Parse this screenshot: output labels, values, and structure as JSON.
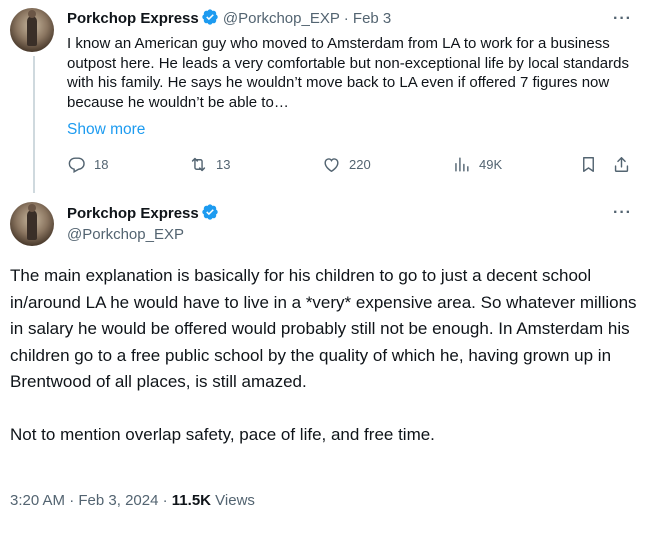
{
  "tweet1": {
    "author_name": "Porkchop Express",
    "handle": "@Porkchop_EXP",
    "separator": "·",
    "date": "Feb 3",
    "text": "I know an American guy who moved to Amsterdam from LA to work for a business outpost here. He leads a very comfortable but non-exceptional life by local standards with his family. He says he wouldn’t move back to LA even if offered 7 figures now because he wouldn’t be able to…",
    "show_more": "Show more",
    "actions": {
      "replies": "18",
      "reposts": "13",
      "likes": "220",
      "views": "49K"
    }
  },
  "tweet2": {
    "author_name": "Porkchop Express",
    "handle": "@Porkchop_EXP",
    "paragraph1": "The main explanation is basically for his children to go to just a decent school in/around LA he would have to live in a *very* expensive area. So whatever millions in salary he would be offered would probably still not be enough. In Amsterdam his children go to a free public school by the quality of which he, having grown up in Brentwood of all places, is still amazed.",
    "paragraph2": "Not to mention overlap safety, pace of life, and free time.",
    "time": "3:20 AM",
    "separator": "·",
    "date": "Feb 3, 2024",
    "views_count": "11.5K",
    "views_label": "Views"
  },
  "icons": {
    "more": "more-icon",
    "verified": "verified-badge-icon",
    "reply": "reply-icon",
    "repost": "repost-icon",
    "like": "heart-icon",
    "views": "views-icon",
    "bookmark": "bookmark-icon",
    "share": "share-icon"
  },
  "colors": {
    "text": "#0f1419",
    "secondary": "#536471",
    "link": "#1d9bf0",
    "verified": "#1d9bf0",
    "thread_line": "#cfd9de"
  }
}
